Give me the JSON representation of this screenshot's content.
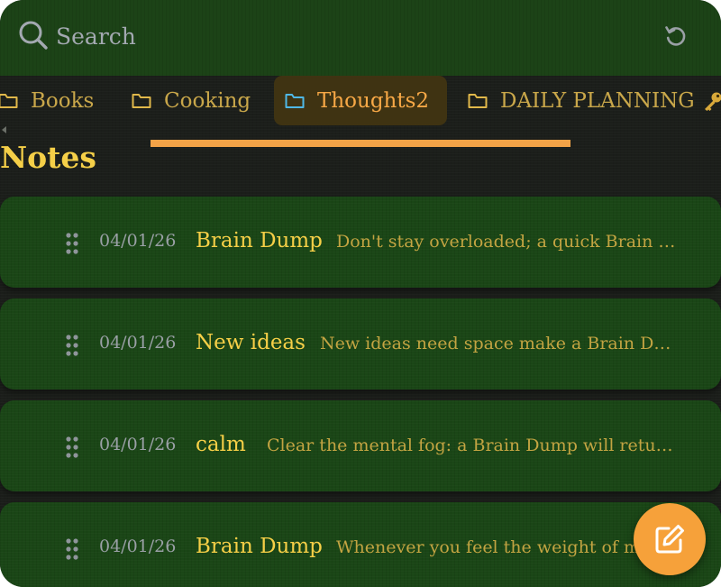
{
  "search": {
    "placeholder": "Search"
  },
  "folders": [
    {
      "label": "Books",
      "active": false
    },
    {
      "label": "Cooking",
      "active": false
    },
    {
      "label": "Thoughts2",
      "active": true
    },
    {
      "label": "DAILY PLANNING",
      "active": false,
      "locked": true
    }
  ],
  "section_title": "Notes",
  "notes": [
    {
      "date": "04/01/26",
      "title": "Brain Dump",
      "preview": "Don't stay overloaded; a quick Brain D..."
    },
    {
      "date": "04/01/26",
      "title": "New ideas",
      "preview": "New ideas need space make a Brain Dum..."
    },
    {
      "date": "04/01/26",
      "title": "calm",
      "preview": "Clear the mental fog: a Brain Dump will return ..."
    },
    {
      "date": "04/01/26",
      "title": "Brain Dump",
      "preview": "Whenever you feel the weight of me"
    }
  ],
  "colors": {
    "header_bg": "#1c4317",
    "card_bg": "#1a4616",
    "title_yellow": "#f6cf47",
    "accent_orange": "#f6a13a",
    "active_tab_bg": "#3f3312"
  },
  "icons": {
    "search": "search-icon",
    "refresh": "refresh-icon",
    "folder": "folder-icon",
    "key": "key-icon",
    "drag": "drag-handle-icon",
    "edit": "edit-note-icon"
  }
}
